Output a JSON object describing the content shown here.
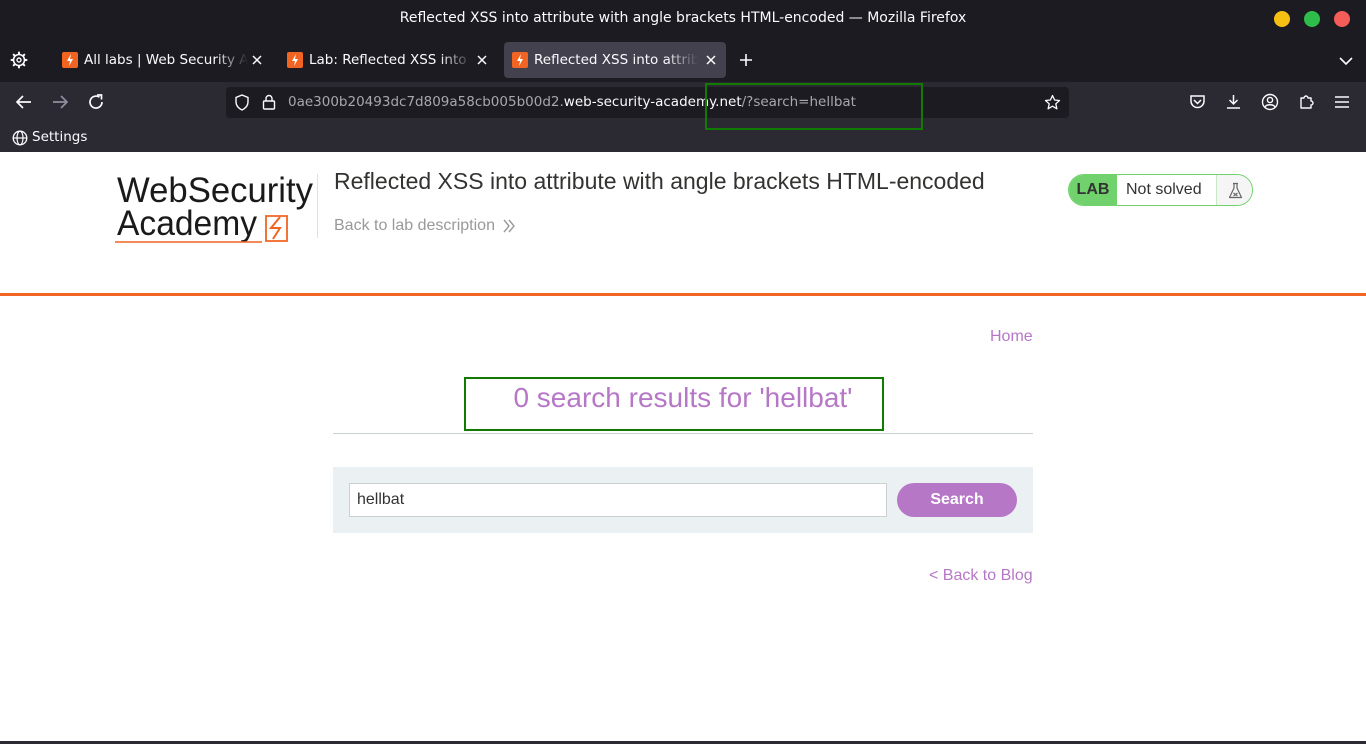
{
  "window": {
    "title": "Reflected XSS into attribute with angle brackets HTML-encoded — Mozilla Firefox",
    "controls": {
      "minimize_color": "#f6c013",
      "maximize_color": "#2ebd4a",
      "close_color": "#f55d58"
    }
  },
  "tabs": [
    {
      "label": "All labs | Web Security Academy",
      "active": false,
      "favicon": "lightning-favicon"
    },
    {
      "label": "Lab: Reflected XSS into attribute",
      "active": false,
      "favicon": "lightning-favicon"
    },
    {
      "label": "Reflected XSS into attribute",
      "active": true,
      "favicon": "lightning-favicon"
    }
  ],
  "urlbar": {
    "subdomain": "0ae300b20493dc7d809a58cb005b00d2.",
    "domain": "web-security-academy.net",
    "path": "/?search=hellbat"
  },
  "bookmarks": [
    {
      "label": "Settings",
      "icon": "globe-icon"
    }
  ],
  "header": {
    "logo_line1": "WebSecurity",
    "logo_line2": "Academy",
    "lab_title": "Reflected XSS into attribute with angle brackets HTML-encoded",
    "back_to_description": "Back to lab description",
    "lab_badge": "LAB",
    "lab_status": "Not solved"
  },
  "nav": {
    "home": "Home"
  },
  "results": {
    "heading": "0 search results for 'hellbat'"
  },
  "search": {
    "value": "hellbat",
    "button": "Search"
  },
  "footer": {
    "back_to_blog": "< Back to Blog"
  },
  "colors": {
    "accent_purple": "#b677c7",
    "brand_orange": "#f26422",
    "lab_green": "#70d16d",
    "highlight_green": "#117a00"
  }
}
